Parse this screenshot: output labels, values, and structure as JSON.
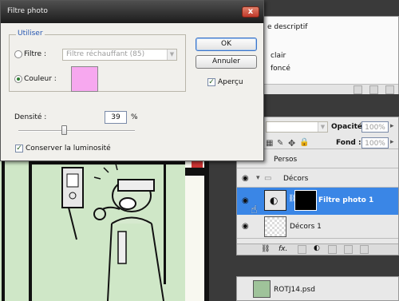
{
  "dialog": {
    "title": "Filtre photo",
    "close_label": "x",
    "group_label": "Utiliser",
    "filter_label": "Filtre :",
    "filter_value": "Filtre réchauffant (85)",
    "color_label": "Couleur :",
    "swatch_color": "#f7a8ef",
    "ok_label": "OK",
    "cancel_label": "Annuler",
    "preview_label": "Aperçu",
    "density_label": "Densité :",
    "density_value": "39",
    "density_unit": "%",
    "density_level": 39,
    "luminosity_label": "Conserver la luminosité"
  },
  "actions": {
    "items": [
      "e descriptif",
      "clair",
      "foncé"
    ]
  },
  "layers": {
    "opacity_label": "Opacité :",
    "opacity_value": "100%",
    "fill_label": "Fond :",
    "fill_value": "100%",
    "rows": [
      {
        "name": "Persos"
      },
      {
        "name": "Décors"
      },
      {
        "name": "Filtre photo 1"
      },
      {
        "name": "Décors 1"
      }
    ],
    "selected_color": "#3a86e6"
  },
  "history": {
    "file": "ROTJ14.psd"
  }
}
